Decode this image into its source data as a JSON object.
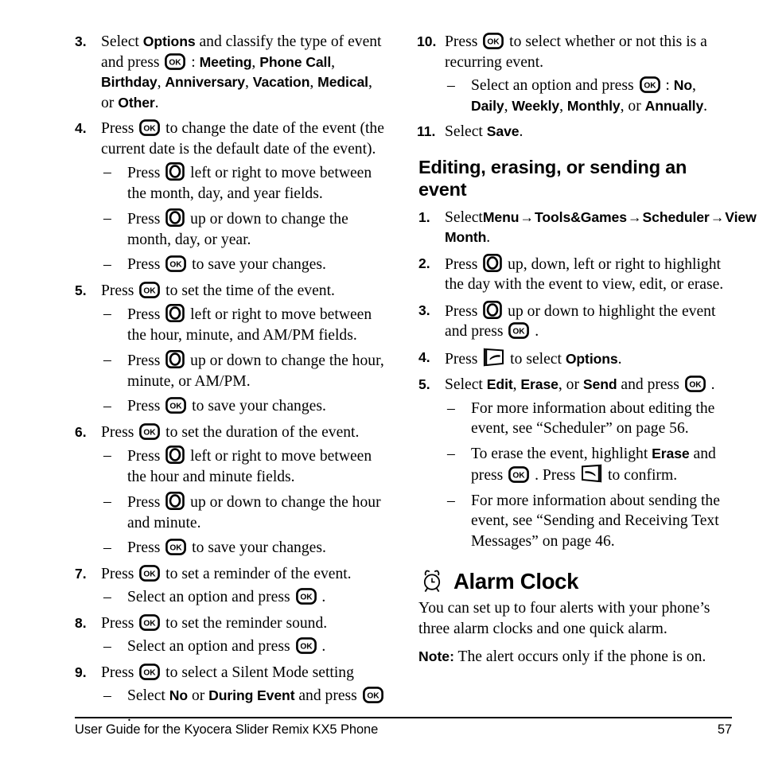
{
  "page": {
    "number": "57",
    "footer_title": "User Guide for the Kyocera Slider Remix KX5 Phone"
  },
  "icons": {
    "ok_key": "ok-key-icon",
    "nav_key": "navigation-key-icon",
    "left_softkey": "left-softkey-icon",
    "right_softkey": "right-softkey-icon",
    "alarm_clock": "alarm-clock-icon",
    "arrow": "→"
  },
  "left_column": {
    "steps": [
      {
        "num": "3.",
        "parts": [
          {
            "t": "text",
            "v": "Select "
          },
          {
            "t": "ui",
            "v": "Options"
          },
          {
            "t": "text",
            "v": " and classify the type of event and press "
          },
          {
            "t": "key",
            "v": "ok_key"
          },
          {
            "t": "text",
            "v": " : "
          },
          {
            "t": "ui",
            "v": "Meeting"
          },
          {
            "t": "text",
            "v": ", "
          },
          {
            "t": "ui",
            "v": "Phone Call"
          },
          {
            "t": "text",
            "v": ", "
          },
          {
            "t": "ui",
            "v": "Birthday"
          },
          {
            "t": "text",
            "v": ", "
          },
          {
            "t": "ui",
            "v": "Anniversary"
          },
          {
            "t": "text",
            "v": ", "
          },
          {
            "t": "ui",
            "v": "Vacation"
          },
          {
            "t": "text",
            "v": ", "
          },
          {
            "t": "ui",
            "v": "Medical"
          },
          {
            "t": "text",
            "v": ", or "
          },
          {
            "t": "ui",
            "v": "Other"
          },
          {
            "t": "text",
            "v": "."
          }
        ],
        "subs": []
      },
      {
        "num": "4.",
        "parts": [
          {
            "t": "text",
            "v": "Press "
          },
          {
            "t": "key",
            "v": "ok_key"
          },
          {
            "t": "text",
            "v": " to change the date of the event (the current date is the default date of the event)."
          }
        ],
        "subs": [
          {
            "parts": [
              {
                "t": "text",
                "v": "Press "
              },
              {
                "t": "key",
                "v": "nav_key"
              },
              {
                "t": "text",
                "v": " left or right to move between the month, day, and year fields."
              }
            ]
          },
          {
            "parts": [
              {
                "t": "text",
                "v": "Press "
              },
              {
                "t": "key",
                "v": "nav_key"
              },
              {
                "t": "text",
                "v": " up or down to change the month, day, or year."
              }
            ]
          },
          {
            "parts": [
              {
                "t": "text",
                "v": "Press "
              },
              {
                "t": "key",
                "v": "ok_key"
              },
              {
                "t": "text",
                "v": " to save your changes."
              }
            ]
          }
        ]
      },
      {
        "num": "5.",
        "parts": [
          {
            "t": "text",
            "v": "Press "
          },
          {
            "t": "key",
            "v": "ok_key"
          },
          {
            "t": "text",
            "v": " to set the time of the event."
          }
        ],
        "subs": [
          {
            "parts": [
              {
                "t": "text",
                "v": "Press "
              },
              {
                "t": "key",
                "v": "nav_key"
              },
              {
                "t": "text",
                "v": " left or right to move between the hour, minute, and AM/PM fields."
              }
            ]
          },
          {
            "parts": [
              {
                "t": "text",
                "v": "Press "
              },
              {
                "t": "key",
                "v": "nav_key"
              },
              {
                "t": "text",
                "v": " up or down to change the hour, minute, or AM/PM."
              }
            ]
          },
          {
            "parts": [
              {
                "t": "text",
                "v": "Press "
              },
              {
                "t": "key",
                "v": "ok_key"
              },
              {
                "t": "text",
                "v": " to save your changes."
              }
            ]
          }
        ]
      },
      {
        "num": "6.",
        "parts": [
          {
            "t": "text",
            "v": "Press "
          },
          {
            "t": "key",
            "v": "ok_key"
          },
          {
            "t": "text",
            "v": " to set the duration of the event."
          }
        ],
        "subs": [
          {
            "parts": [
              {
                "t": "text",
                "v": "Press "
              },
              {
                "t": "key",
                "v": "nav_key"
              },
              {
                "t": "text",
                "v": " left or right to move between the hour and minute fields."
              }
            ]
          },
          {
            "parts": [
              {
                "t": "text",
                "v": "Press "
              },
              {
                "t": "key",
                "v": "nav_key"
              },
              {
                "t": "text",
                "v": " up or down to change the hour and minute."
              }
            ]
          },
          {
            "parts": [
              {
                "t": "text",
                "v": "Press "
              },
              {
                "t": "key",
                "v": "ok_key"
              },
              {
                "t": "text",
                "v": " to save your changes."
              }
            ]
          }
        ]
      },
      {
        "num": "7.",
        "parts": [
          {
            "t": "text",
            "v": "Press "
          },
          {
            "t": "key",
            "v": "ok_key"
          },
          {
            "t": "text",
            "v": " to set a reminder of the event."
          }
        ],
        "subs": [
          {
            "parts": [
              {
                "t": "text",
                "v": "Select an option and press "
              },
              {
                "t": "key",
                "v": "ok_key"
              },
              {
                "t": "text",
                "v": " ."
              }
            ]
          }
        ]
      },
      {
        "num": "8.",
        "parts": [
          {
            "t": "text",
            "v": "Press "
          },
          {
            "t": "key",
            "v": "ok_key"
          },
          {
            "t": "text",
            "v": " to set the reminder sound."
          }
        ],
        "subs": [
          {
            "parts": [
              {
                "t": "text",
                "v": "Select an option and press "
              },
              {
                "t": "key",
                "v": "ok_key"
              },
              {
                "t": "text",
                "v": " ."
              }
            ]
          }
        ]
      },
      {
        "num": "9.",
        "parts": [
          {
            "t": "text",
            "v": "Press "
          },
          {
            "t": "key",
            "v": "ok_key"
          },
          {
            "t": "text",
            "v": " to select a Silent Mode setting"
          }
        ],
        "subs": [
          {
            "parts": [
              {
                "t": "text",
                "v": "Select "
              },
              {
                "t": "ui",
                "v": "No"
              },
              {
                "t": "text",
                "v": " or "
              },
              {
                "t": "ui",
                "v": "During Event"
              },
              {
                "t": "text",
                "v": " and press "
              },
              {
                "t": "key",
                "v": "ok_key"
              },
              {
                "t": "text",
                "v": " ."
              }
            ]
          }
        ]
      }
    ]
  },
  "right_column": {
    "steps_top": [
      {
        "num": "10.",
        "parts": [
          {
            "t": "text",
            "v": "Press "
          },
          {
            "t": "key",
            "v": "ok_key"
          },
          {
            "t": "text",
            "v": " to select whether or not this is a recurring event."
          }
        ],
        "subs": [
          {
            "parts": [
              {
                "t": "text",
                "v": "Select an option and press "
              },
              {
                "t": "key",
                "v": "ok_key"
              },
              {
                "t": "text",
                "v": " : "
              },
              {
                "t": "ui",
                "v": "No"
              },
              {
                "t": "text",
                "v": ", "
              },
              {
                "t": "ui",
                "v": "Daily"
              },
              {
                "t": "text",
                "v": ", "
              },
              {
                "t": "ui",
                "v": "Weekly"
              },
              {
                "t": "text",
                "v": ", "
              },
              {
                "t": "ui",
                "v": "Monthly"
              },
              {
                "t": "text",
                "v": ", or "
              },
              {
                "t": "ui",
                "v": "Annually"
              },
              {
                "t": "text",
                "v": "."
              }
            ]
          }
        ]
      },
      {
        "num": "11.",
        "parts": [
          {
            "t": "text",
            "v": "Select "
          },
          {
            "t": "ui",
            "v": "Save"
          },
          {
            "t": "text",
            "v": "."
          }
        ],
        "subs": []
      }
    ],
    "section_heading": "Editing, erasing, or sending an event",
    "steps_section": [
      {
        "num": "1.",
        "parts": [
          {
            "t": "text",
            "v": "Select"
          },
          {
            "t": "ui",
            "v": "Menu"
          },
          {
            "t": "arrow",
            "v": "→"
          },
          {
            "t": "ui",
            "v": "Tools&Games"
          },
          {
            "t": "arrow",
            "v": "→"
          },
          {
            "t": "ui",
            "v": "Scheduler"
          },
          {
            "t": "arrow",
            "v": "→"
          },
          {
            "t": "ui",
            "v": "View Month"
          },
          {
            "t": "text",
            "v": "."
          }
        ],
        "subs": []
      },
      {
        "num": "2.",
        "parts": [
          {
            "t": "text",
            "v": "Press "
          },
          {
            "t": "key",
            "v": "nav_key"
          },
          {
            "t": "text",
            "v": " up, down, left or right to highlight the day with the event to view, edit, or erase."
          }
        ],
        "subs": []
      },
      {
        "num": "3.",
        "parts": [
          {
            "t": "text",
            "v": "Press "
          },
          {
            "t": "key",
            "v": "nav_key"
          },
          {
            "t": "text",
            "v": " up or down to highlight the event and press "
          },
          {
            "t": "key",
            "v": "ok_key"
          },
          {
            "t": "text",
            "v": " ."
          }
        ],
        "subs": []
      },
      {
        "num": "4.",
        "parts": [
          {
            "t": "text",
            "v": "Press "
          },
          {
            "t": "key",
            "v": "left_softkey"
          },
          {
            "t": "text",
            "v": " to select "
          },
          {
            "t": "ui",
            "v": "Options"
          },
          {
            "t": "text",
            "v": "."
          }
        ],
        "subs": []
      },
      {
        "num": "5.",
        "parts": [
          {
            "t": "text",
            "v": "Select "
          },
          {
            "t": "ui",
            "v": "Edit"
          },
          {
            "t": "text",
            "v": ", "
          },
          {
            "t": "ui",
            "v": "Erase"
          },
          {
            "t": "text",
            "v": ", or "
          },
          {
            "t": "ui",
            "v": "Send"
          },
          {
            "t": "text",
            "v": " and press "
          },
          {
            "t": "key",
            "v": "ok_key"
          },
          {
            "t": "text",
            "v": " ."
          }
        ],
        "subs": [
          {
            "parts": [
              {
                "t": "text",
                "v": "For more information about editing the event, see “Scheduler” on page 56."
              }
            ]
          },
          {
            "parts": [
              {
                "t": "text",
                "v": "To erase the event, highlight "
              },
              {
                "t": "ui",
                "v": "Erase"
              },
              {
                "t": "text",
                "v": " and press "
              },
              {
                "t": "key",
                "v": "ok_key"
              },
              {
                "t": "text",
                "v": " . Press "
              },
              {
                "t": "key",
                "v": "right_softkey"
              },
              {
                "t": "text",
                "v": " to confirm."
              }
            ]
          },
          {
            "parts": [
              {
                "t": "text",
                "v": "For more information about sending the event, see “Sending and Receiving Text Messages” on page 46."
              }
            ]
          }
        ]
      }
    ],
    "chapter_heading": "Alarm Clock",
    "chapter_body": "You can set up to four alerts with your phone’s three alarm clocks and one quick alarm.",
    "note_label": "Note:",
    "note_text": "The alert occurs only if the phone is on."
  }
}
